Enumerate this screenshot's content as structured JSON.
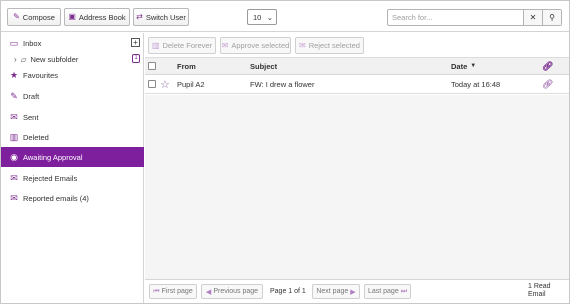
{
  "toolbar": {
    "compose": "Compose",
    "address_book": "Address Book",
    "switch_user": "Switch User",
    "per_page": "10",
    "search_placeholder": "Search for..."
  },
  "sidebar": {
    "items": [
      {
        "label": "Inbox",
        "icon": "inbox-icon"
      },
      {
        "label": "New subfolder",
        "icon": "folder-icon",
        "badge": "1"
      },
      {
        "label": "Favourites",
        "icon": "star-icon"
      },
      {
        "label": "Draft",
        "icon": "pencil-icon"
      },
      {
        "label": "Sent",
        "icon": "sent-icon"
      },
      {
        "label": "Deleted",
        "icon": "trash-icon"
      },
      {
        "label": "Awaiting Approval",
        "icon": "approval-icon",
        "active": true
      },
      {
        "label": "Rejected Emails",
        "icon": "rejected-icon"
      },
      {
        "label": "Reported emails (4)",
        "icon": "report-icon"
      }
    ]
  },
  "actions": {
    "delete_forever": "Delete Forever",
    "approve_selected": "Approve selected",
    "reject_selected": "Reject selected"
  },
  "table": {
    "columns": {
      "from": "From",
      "subject": "Subject",
      "date": "Date"
    },
    "rows": [
      {
        "from": "Pupil A2",
        "subject": "FW: I drew a flower",
        "date": "Today at 16:48"
      }
    ]
  },
  "pager": {
    "first": "First page",
    "previous": "Previous page",
    "info": "Page 1 of 1",
    "next": "Next page",
    "last": "Last page",
    "count": "1 Read Email"
  },
  "colors": {
    "accent": "#7e1f9e"
  }
}
